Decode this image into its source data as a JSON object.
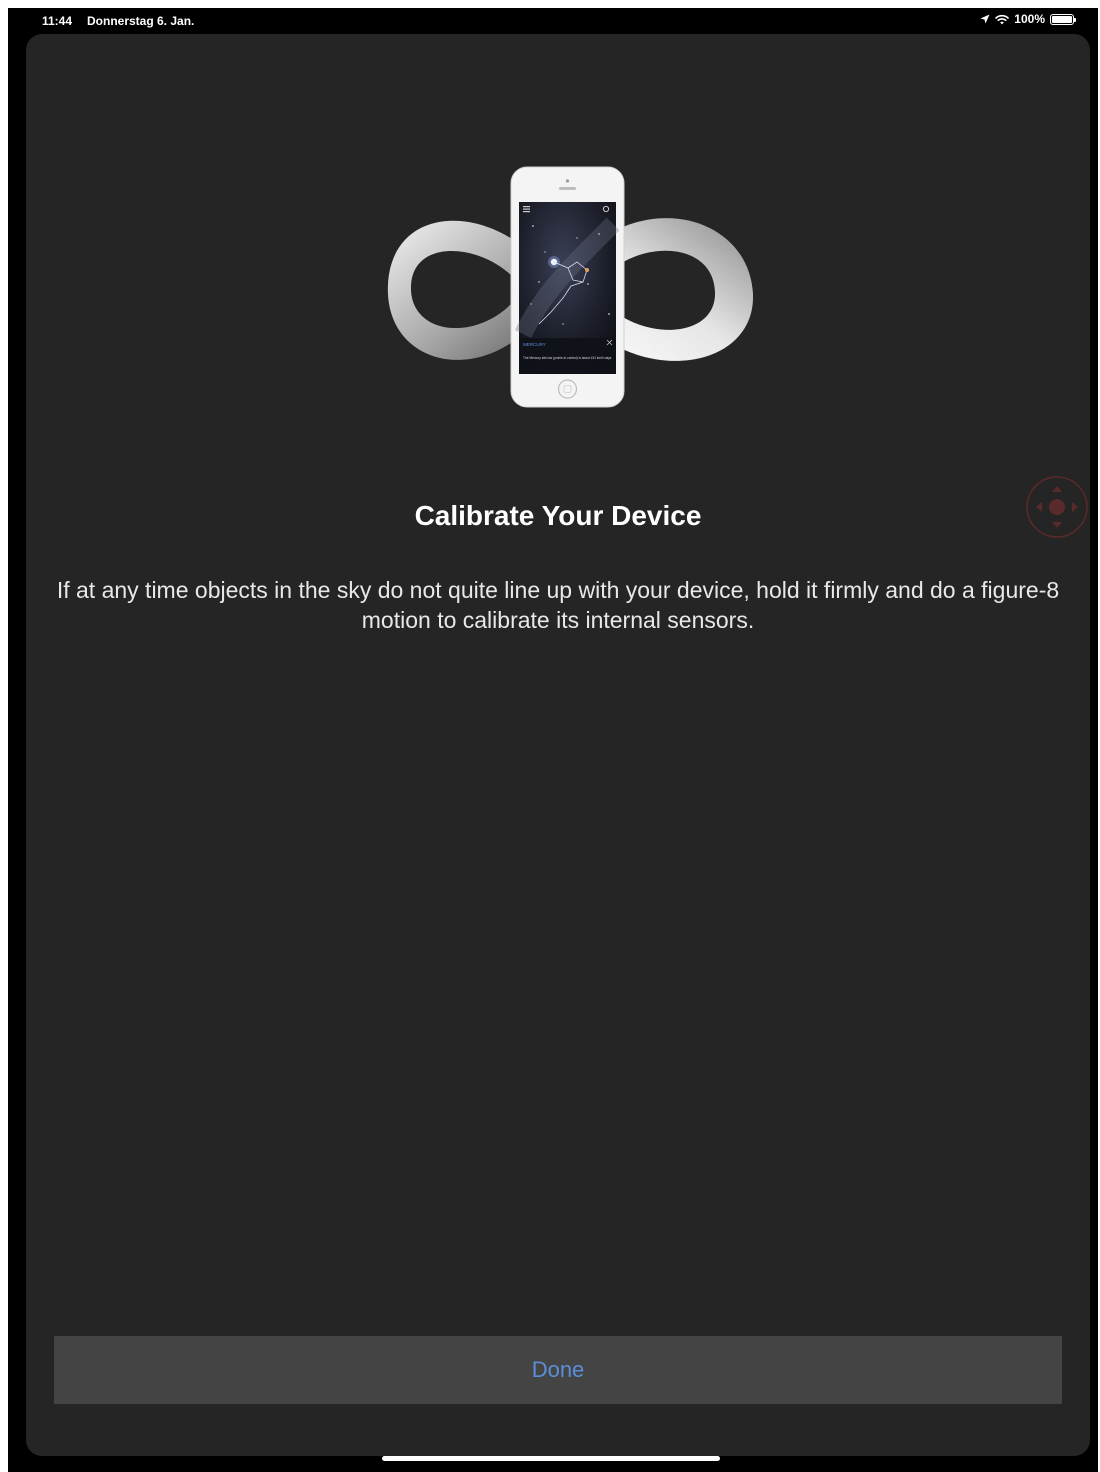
{
  "status_bar": {
    "time": "11:44",
    "date": "Donnerstag 6. Jan.",
    "battery": "100%",
    "icons": [
      "location-arrow-icon",
      "wifi-icon",
      "battery-icon"
    ]
  },
  "dialog": {
    "title": "Calibrate Your Device",
    "body": "If at any time objects in the sky do not quite line up with your device, hold it firmly and do a figure-8 motion to calibrate its internal sensors.",
    "done_label": "Done",
    "illustration": {
      "card_title": "MERCURY",
      "card_text": "The Mercury sits low (points to control) is about 151 km/h days"
    }
  },
  "colors": {
    "sheet_background": "#252525",
    "button_background": "#444444",
    "button_text": "#5a8fd8",
    "assistive_touch": "#5a2a2a"
  }
}
